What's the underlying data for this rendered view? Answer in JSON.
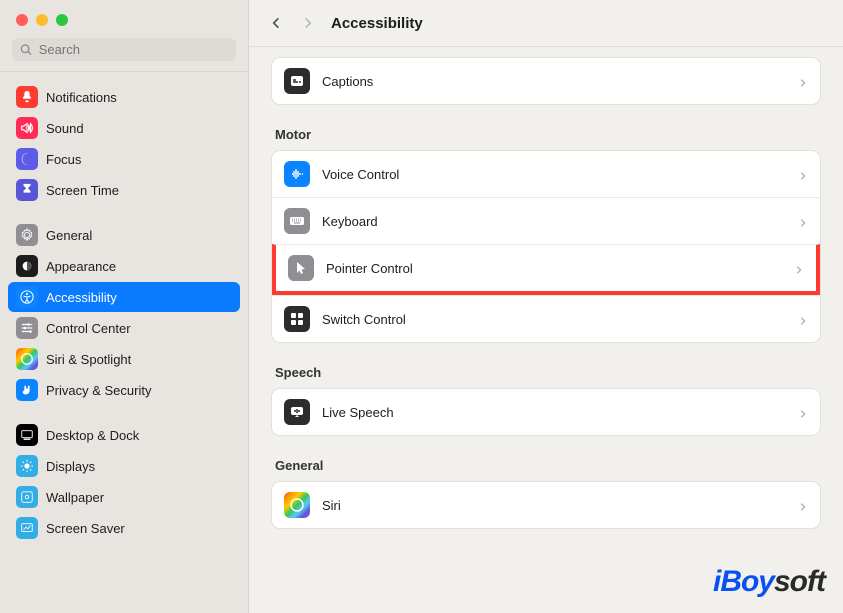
{
  "traffic": {
    "red": "#ff5f57",
    "yellow": "#febc2e",
    "green": "#28c840"
  },
  "search": {
    "placeholder": "Search"
  },
  "header": {
    "title": "Accessibility"
  },
  "sidebar": [
    {
      "label": "Notifications",
      "icon": "bell",
      "bg": "bg-red"
    },
    {
      "label": "Sound",
      "icon": "speaker",
      "bg": "bg-pink"
    },
    {
      "label": "Focus",
      "icon": "moon",
      "bg": "bg-purple"
    },
    {
      "label": "Screen Time",
      "icon": "hourglass",
      "bg": "bg-indigo"
    },
    {
      "spacer": true
    },
    {
      "label": "General",
      "icon": "gear",
      "bg": "bg-gray"
    },
    {
      "label": "Appearance",
      "icon": "appearance",
      "bg": "bg-graydark"
    },
    {
      "label": "Accessibility",
      "icon": "accessibility",
      "bg": "bg-blue",
      "selected": true
    },
    {
      "label": "Control Center",
      "icon": "sliders",
      "bg": "bg-gray"
    },
    {
      "label": "Siri & Spotlight",
      "icon": "siri",
      "bg": "bg-grad"
    },
    {
      "label": "Privacy & Security",
      "icon": "hand",
      "bg": "bg-blue"
    },
    {
      "spacer": true
    },
    {
      "label": "Desktop & Dock",
      "icon": "dock",
      "bg": "bg-black"
    },
    {
      "label": "Displays",
      "icon": "display",
      "bg": "bg-cyan"
    },
    {
      "label": "Wallpaper",
      "icon": "wallpaper",
      "bg": "bg-cyan"
    },
    {
      "label": "Screen Saver",
      "icon": "screensaver",
      "bg": "bg-cyan"
    }
  ],
  "sections": [
    {
      "title": null,
      "rows": [
        {
          "label": "Captions",
          "icon": "captions",
          "bg": "bg-darkgray"
        }
      ]
    },
    {
      "title": "Motor",
      "rows": [
        {
          "label": "Voice Control",
          "icon": "voicecontrol",
          "bg": "bg-blue"
        },
        {
          "label": "Keyboard",
          "icon": "keyboard",
          "bg": "bg-gray"
        },
        {
          "label": "Pointer Control",
          "icon": "pointer",
          "bg": "bg-gray",
          "highlight": true
        },
        {
          "label": "Switch Control",
          "icon": "switchcontrol",
          "bg": "bg-darkgray"
        }
      ]
    },
    {
      "title": "Speech",
      "rows": [
        {
          "label": "Live Speech",
          "icon": "livespeech",
          "bg": "bg-darkgray"
        }
      ]
    },
    {
      "title": "General",
      "rows": [
        {
          "label": "Siri",
          "icon": "siri",
          "bg": "bg-grad"
        }
      ]
    }
  ],
  "watermark": {
    "part1": "iBoy",
    "part2": "soft"
  }
}
